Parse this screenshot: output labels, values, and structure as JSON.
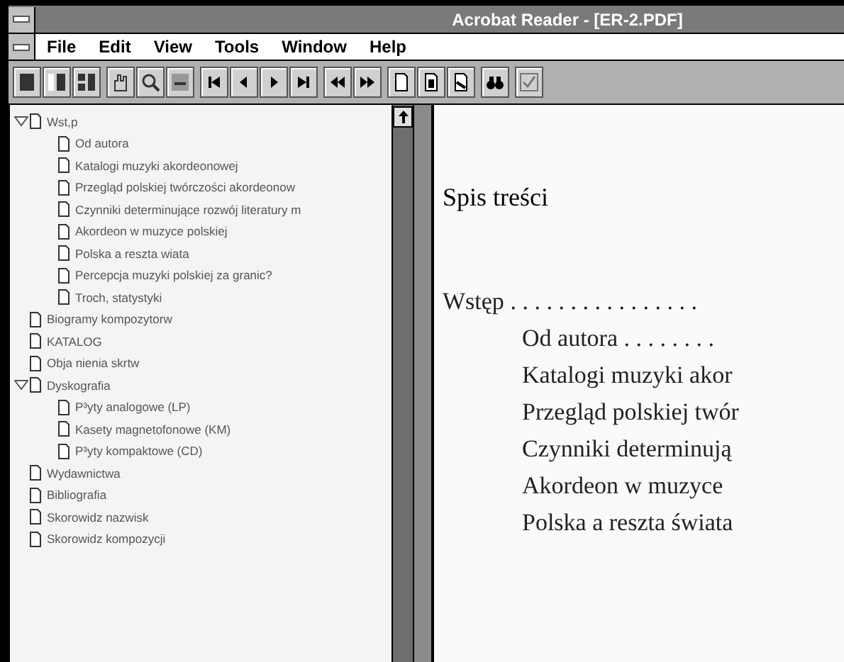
{
  "window": {
    "title": "Acrobat Reader - [ER-2.PDF]"
  },
  "menu": [
    "File",
    "Edit",
    "View",
    "Tools",
    "Window",
    "Help"
  ],
  "toolbar": [
    [
      {
        "kind": "page-only"
      },
      {
        "kind": "bookmarks"
      },
      {
        "kind": "thumbnails"
      }
    ],
    [
      {
        "kind": "hand"
      },
      {
        "kind": "zoom"
      },
      {
        "kind": "select"
      }
    ],
    [
      {
        "kind": "first"
      },
      {
        "kind": "prev"
      },
      {
        "kind": "next"
      },
      {
        "kind": "last"
      }
    ],
    [
      {
        "kind": "back"
      },
      {
        "kind": "forward"
      }
    ],
    [
      {
        "kind": "actual"
      },
      {
        "kind": "fit-page"
      },
      {
        "kind": "fit-width"
      }
    ],
    [
      {
        "kind": "find"
      }
    ],
    [
      {
        "kind": "check"
      }
    ]
  ],
  "bookmarks": [
    {
      "label": "Wst,p",
      "expanded": true,
      "children": [
        {
          "label": "Od autora"
        },
        {
          "label": "Katalogi muzyki akordeonowej"
        },
        {
          "label": "Przegląd polskiej twórczości akordeonow"
        },
        {
          "label": "Czynniki determinujące rozwój literatury m"
        },
        {
          "label": "Akordeon w muzyce polskiej"
        },
        {
          "label": "Polska a reszta  wiata"
        },
        {
          "label": "Percepcja muzyki polskiej za granic?"
        },
        {
          "label": "Troch, statystyki"
        }
      ]
    },
    {
      "label": "Biogramy kompozytorw"
    },
    {
      "label": "KATALOG"
    },
    {
      "label": "Obja nienia skrtw"
    },
    {
      "label": "Dyskografia",
      "expanded": true,
      "children": [
        {
          "label": "P³yty analogowe (LP)"
        },
        {
          "label": "Kasety magnetofonowe (KM)"
        },
        {
          "label": "P³yty kompaktowe (CD)"
        }
      ]
    },
    {
      "label": "Wydawnictwa"
    },
    {
      "label": "Bibliografia"
    },
    {
      "label": "Skorowidz nazwisk"
    },
    {
      "label": "Skorowidz kompozycji"
    }
  ],
  "page": {
    "heading": "Spis treści",
    "toc": [
      {
        "text": "Wstęp",
        "leader": ". . . . . . . . . . . . . . . .",
        "kind": "chapter"
      },
      {
        "text": "Od autora",
        "leader": ". . . . . . . .",
        "kind": "section"
      },
      {
        "text": "Katalogi muzyki akor",
        "kind": "section"
      },
      {
        "text": "Przegląd polskiej twór",
        "kind": "section"
      },
      {
        "text": "Czynniki determinują",
        "kind": "section"
      },
      {
        "text": "Akordeon w muzyce",
        "kind": "section"
      },
      {
        "text": "Polska a reszta świata",
        "kind": "section"
      }
    ]
  }
}
